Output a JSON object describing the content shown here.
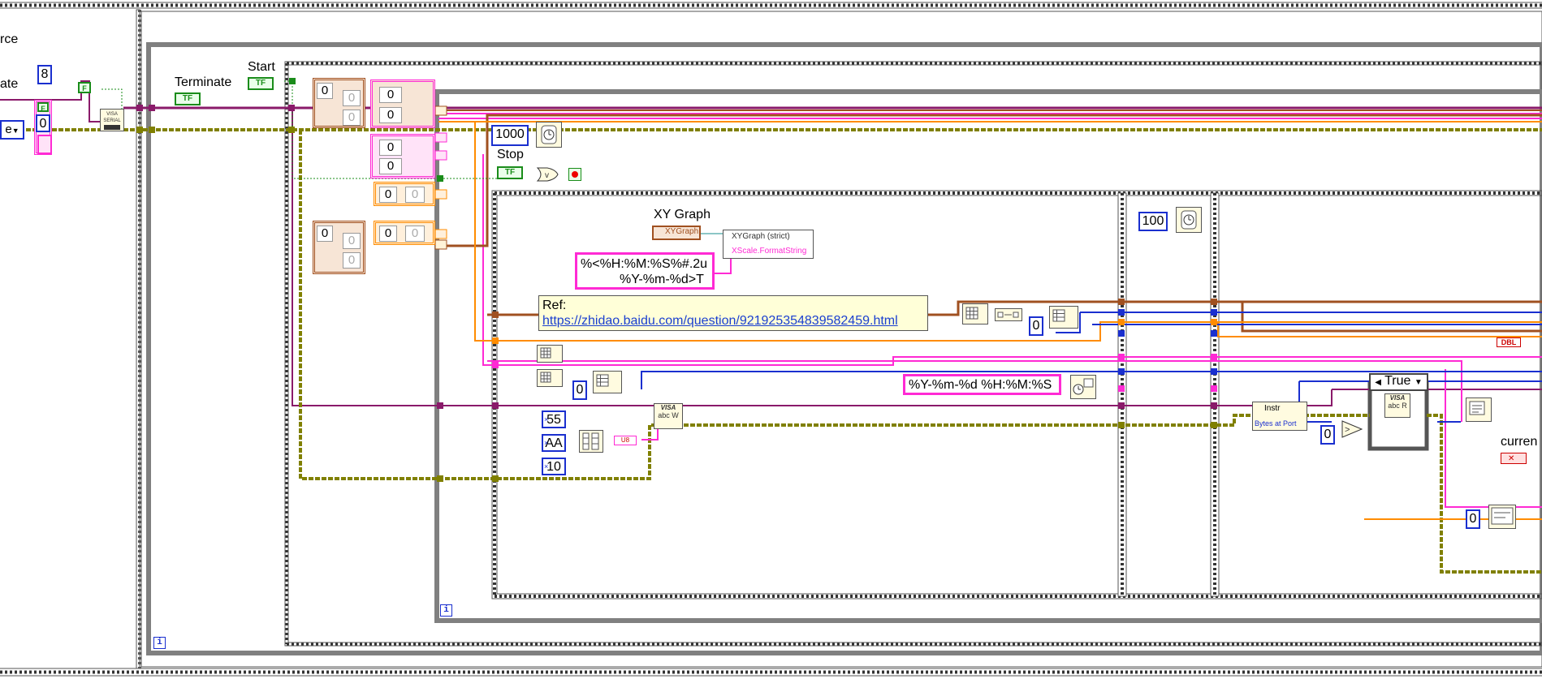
{
  "labels": {
    "source_partial": "rce",
    "rate_partial": "ate",
    "terminate": "Terminate",
    "start": "Start",
    "stop": "Stop",
    "xy_graph": "XY Graph",
    "current_partial": "curren"
  },
  "constants": {
    "data_bits": "8",
    "zero_a": "0",
    "zero_b": "0",
    "wait_ms": "1000",
    "wait_100": "100",
    "hex_55": "55",
    "hex_aa": "AA",
    "hex_10": "10",
    "bool_false": "F",
    "tf": "TF",
    "parity_partial": "e"
  },
  "cluster_cells": {
    "c1": [
      "0",
      "0",
      "0"
    ],
    "c2": [
      "0",
      "0"
    ],
    "c3": [
      "0",
      "0"
    ],
    "c4": [
      "0",
      "0"
    ],
    "c5": [
      "0",
      "0",
      "0",
      "0"
    ]
  },
  "strings": {
    "format_string_line1": "%<%H:%M:%S%#.2u",
    "format_string_line2": "%Y-%m-%d>T",
    "time_format": "%Y-%m-%d %H:%M:%S",
    "ref_title": "Ref:",
    "ref_url": "https://zhidao.baidu.com/question/921925354839582459.html"
  },
  "nodes": {
    "xygraph_ref": "XYGraph",
    "xygraph_strict": "XYGraph (strict)",
    "xscale_format": "XScale.FormatString",
    "instr": "Instr",
    "bytes_at_port": "Bytes at Port",
    "visa_serial": "VISA SERIAL",
    "visa": "VISA",
    "dbl": "DBL",
    "u8": "U8"
  },
  "case_structure": {
    "selected": "True"
  },
  "iteration_terminal": "i",
  "colors": {
    "brown_wire": "#a05020",
    "pink_wire": "#ff2ad4",
    "orange_wire": "#ff8c00",
    "blue_wire": "#1a2fcf",
    "purple_wire": "#8a1a6a",
    "olive_wire": "#808000",
    "green_wire": "#1a8c1a",
    "frame_grey": "#808080"
  }
}
